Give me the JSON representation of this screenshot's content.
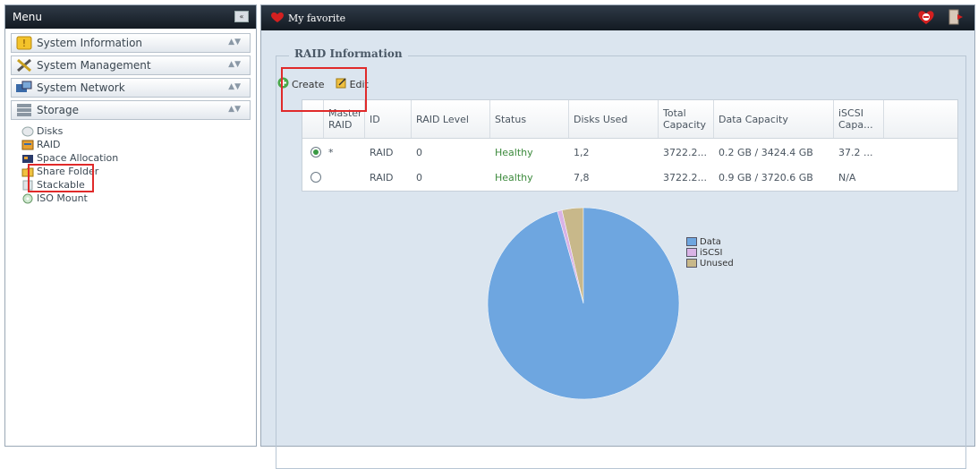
{
  "menu": {
    "title": "Menu",
    "collapse_label": "«",
    "sections": [
      {
        "label": "System Information",
        "icon": "info-icon"
      },
      {
        "label": "System Management",
        "icon": "tools-icon"
      },
      {
        "label": "System Network",
        "icon": "network-icon"
      },
      {
        "label": "Storage",
        "icon": "storage-icon"
      }
    ],
    "storage_items": [
      {
        "label": "Disks",
        "icon": "disk-icon"
      },
      {
        "label": "RAID",
        "icon": "raid-icon"
      },
      {
        "label": "Space Allocation",
        "icon": "space-allocation-icon"
      },
      {
        "label": "Share Folder",
        "icon": "folder-icon"
      },
      {
        "label": "Stackable",
        "icon": "stackable-icon"
      },
      {
        "label": "ISO Mount",
        "icon": "iso-icon"
      }
    ]
  },
  "topbar": {
    "favorite_label": "My favorite"
  },
  "raid": {
    "title": "RAID Information",
    "toolbar": {
      "create": "Create",
      "edit": "Edit"
    },
    "columns": [
      "Master RAID",
      "ID",
      "RAID Level",
      "Status",
      "Disks Used",
      "Total Capacity",
      "Data Capacity",
      "iSCSI Capa..."
    ],
    "rows": [
      {
        "selected": true,
        "master": "*",
        "id": "RAID",
        "level": "0",
        "status": "Healthy",
        "disks": "1,2",
        "total": "3722.2...",
        "data": "0.2 GB / 3424.4 GB",
        "iscsi": "37.2 ..."
      },
      {
        "selected": false,
        "master": "",
        "id": "RAID",
        "level": "0",
        "status": "Healthy",
        "disks": "7,8",
        "total": "3722.2...",
        "data": "0.9 GB / 3720.6 GB",
        "iscsi": "N/A"
      }
    ]
  },
  "chart_data": {
    "type": "pie",
    "labels": [
      "Data",
      "iSCSI",
      "Unused"
    ],
    "values": [
      95.6,
      0.8,
      3.6
    ],
    "colors": [
      "#6ea6e0",
      "#d9b3e6",
      "#c8b88a"
    ],
    "legend_position": "top-right"
  }
}
